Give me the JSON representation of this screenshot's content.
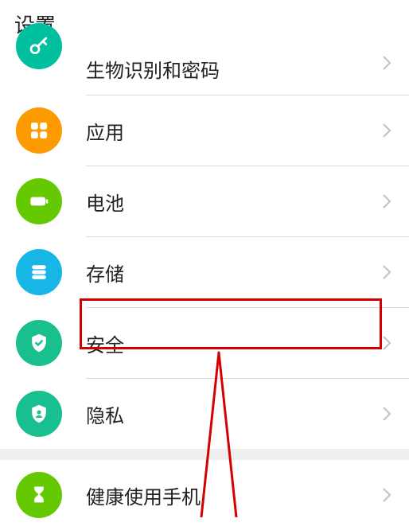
{
  "header": {
    "title": "设置"
  },
  "items": [
    {
      "id": "biometric",
      "label": "生物识别和密码",
      "iconColor": "#00c0a0"
    },
    {
      "id": "apps",
      "label": "应用",
      "iconColor": "#fd9a00"
    },
    {
      "id": "battery",
      "label": "电池",
      "iconColor": "#64c900"
    },
    {
      "id": "storage",
      "label": "存储",
      "iconColor": "#17b6e6"
    },
    {
      "id": "security",
      "label": "安全",
      "iconColor": "#1abf8f"
    },
    {
      "id": "privacy",
      "label": "隐私",
      "iconColor": "#1abf8f"
    },
    {
      "id": "digital",
      "label": "健康使用手机",
      "iconColor": "#64c900"
    }
  ],
  "annotation": {
    "highlight_target": "security"
  }
}
